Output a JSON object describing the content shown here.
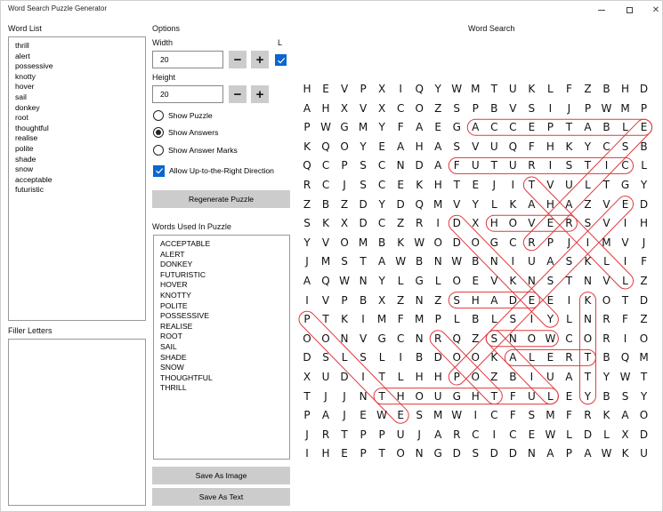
{
  "window": {
    "title": "Word Search Puzzle Generator",
    "controls": {
      "minimize": "–",
      "maximize": "☐",
      "close": "✕"
    }
  },
  "word_list": {
    "label": "Word List",
    "items": [
      "thrill",
      "alert",
      "possessive",
      "knotty",
      "hover",
      "sail",
      "donkey",
      "root",
      "thoughtful",
      "realise",
      "polite",
      "shade",
      "snow",
      "acceptable",
      "futuristic"
    ]
  },
  "filler_letters": {
    "label": "Filler Letters",
    "value": ""
  },
  "options": {
    "label": "Options",
    "width_label": "Width",
    "width_value": "20",
    "height_label": "Height",
    "height_value": "20",
    "decrement_label": "−",
    "increment_label": "+",
    "l_label": "L",
    "l_checked": true,
    "radios": [
      {
        "label": "Show Puzzle",
        "selected": false
      },
      {
        "label": "Show Answers",
        "selected": true
      },
      {
        "label": "Show Answer Marks",
        "selected": false
      }
    ],
    "allow_up_right_label": "Allow Up-to-the-Right Direction",
    "allow_up_right_checked": true,
    "regenerate_label": "Regenerate Puzzle"
  },
  "words_used": {
    "label": "Words Used In Puzzle",
    "items": [
      "ACCEPTABLE",
      "ALERT",
      "DONKEY",
      "FUTURISTIC",
      "HOVER",
      "KNOTTY",
      "POLITE",
      "POSSESSIVE",
      "REALISE",
      "ROOT",
      "SAIL",
      "SHADE",
      "SNOW",
      "THOUGHTFUL",
      "THRILL"
    ]
  },
  "save_image_label": "Save As Image",
  "save_text_label": "Save As Text",
  "word_search": {
    "label": "Word Search",
    "mark_color": "#e0383e",
    "grid": [
      "HEVPXIQYWMTUKLFZBHD",
      "AHXVXCOZSPBVSIJPWMP",
      "PWGMYFAEGACCEPTABLE",
      "KQOYEAHASVUQFHKYCSB",
      "QCPSCNDAFUTURISTICL",
      "RCJSCEKHTEJITVULTGY",
      "ZBZDYDQMVYLKAHAZVED",
      "SKXDCZRIDXHOVERSVIH",
      "YVOMBKWODOGCRPJIMVJ",
      "JMSTAWBNWBNIUASKLIF",
      "AQWNYLGLOEVKNSTNVLZ",
      "IVPBXZNZSHADEEIKOTD",
      "PTKIMFMPLBLSIYLNRFZ",
      "OONVGCNRQZSNOWCORIO",
      "DSLSLIBDOOKALERTBQM",
      "XUDITLHHPOZBIUATYWT",
      "TJJNTHOUGHTFULEYBSY",
      "PAJEWESMWICFSMFRKAO",
      "JRTPPUJARCICEWLDLXD",
      "IHEPTONGDSDDNAPAWKU"
    ],
    "answers": [
      {
        "word": "ACCEPTABLE",
        "start": [
          2,
          9
        ],
        "end": [
          2,
          18
        ]
      },
      {
        "word": "FUTURISTIC",
        "start": [
          4,
          8
        ],
        "end": [
          4,
          17
        ]
      },
      {
        "word": "HOVER",
        "start": [
          7,
          10
        ],
        "end": [
          7,
          14
        ]
      },
      {
        "word": "SHADE",
        "start": [
          11,
          8
        ],
        "end": [
          11,
          12
        ]
      },
      {
        "word": "SNOW",
        "start": [
          13,
          10
        ],
        "end": [
          13,
          13
        ]
      },
      {
        "word": "ALERT",
        "start": [
          14,
          11
        ],
        "end": [
          14,
          15
        ]
      },
      {
        "word": "THOUGHTFUL",
        "start": [
          16,
          4
        ],
        "end": [
          16,
          13
        ]
      },
      {
        "word": "KNOTTY",
        "start": [
          11,
          15
        ],
        "end": [
          16,
          15
        ]
      },
      {
        "word": "POLITE",
        "start": [
          12,
          0
        ],
        "end": [
          17,
          5
        ]
      },
      {
        "word": "DONKEY",
        "start": [
          7,
          8
        ],
        "end": [
          12,
          13
        ]
      },
      {
        "word": "THRILL",
        "start": [
          5,
          12
        ],
        "end": [
          10,
          17
        ]
      },
      {
        "word": "ROOT",
        "start": [
          13,
          7
        ],
        "end": [
          16,
          10
        ]
      },
      {
        "word": "SAIL",
        "start": [
          13,
          10
        ],
        "end": [
          16,
          13
        ]
      },
      {
        "word": "POSSESSIVE",
        "start": [
          15,
          8
        ],
        "end": [
          6,
          17
        ]
      },
      {
        "word": "REALISE",
        "start": [
          8,
          12
        ],
        "end": [
          2,
          18
        ]
      }
    ]
  }
}
